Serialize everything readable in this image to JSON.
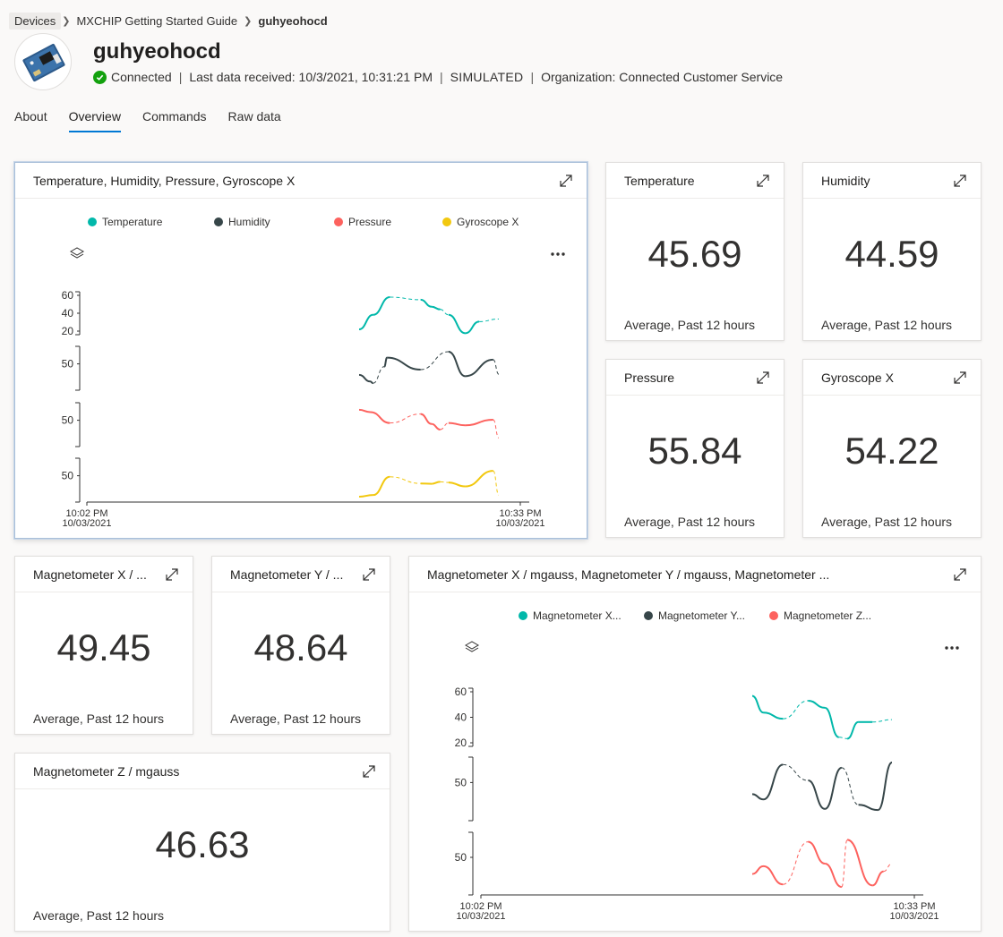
{
  "breadcrumb": [
    "Devices",
    "MXCHIP Getting Started Guide",
    "guhyeohocd"
  ],
  "device": {
    "name": "guhyeohocd",
    "status": "Connected",
    "last_data": "Last data received: 10/3/2021, 10:31:21 PM",
    "simulated": "SIMULATED",
    "organization": "Organization: Connected Customer Service"
  },
  "tabs": [
    "About",
    "Overview",
    "Commands",
    "Raw data"
  ],
  "active_tab": "Overview",
  "colors": {
    "teal": "#01b8aa",
    "dark": "#374649",
    "red": "#fd625e",
    "yellow": "#f2c80f",
    "accent": "#0078d4",
    "connected": "#13a10e"
  },
  "kpis": {
    "temperature": {
      "title": "Temperature",
      "value": "45.69",
      "sub": "Average, Past 12 hours"
    },
    "humidity": {
      "title": "Humidity",
      "value": "44.59",
      "sub": "Average, Past 12 hours"
    },
    "pressure": {
      "title": "Pressure",
      "value": "55.84",
      "sub": "Average, Past 12 hours"
    },
    "gyro": {
      "title": "Gyroscope X",
      "value": "54.22",
      "sub": "Average, Past 12 hours"
    },
    "magx": {
      "title": "Magnetometer X / ...",
      "value": "49.45",
      "sub": "Average, Past 12 hours"
    },
    "magy": {
      "title": "Magnetometer Y / ...",
      "value": "48.64",
      "sub": "Average, Past 12 hours"
    },
    "magz": {
      "title": "Magnetometer Z / mgauss",
      "value": "46.63",
      "sub": "Average, Past 12 hours"
    }
  },
  "chart_data": [
    {
      "type": "line",
      "title": "Temperature, Humidity, Pressure, Gyroscope X",
      "x_start": [
        "10:02 PM",
        "10/03/2021"
      ],
      "x_end": [
        "10:33 PM",
        "10/03/2021"
      ],
      "legend_position": "top",
      "grid": false,
      "series": [
        {
          "name": "Temperature",
          "color": "#01b8aa",
          "y_ticks": [
            "60",
            "40",
            "20"
          ],
          "points": [
            [
              0.0,
              0.0
            ],
            [
              0.1,
              0.45
            ],
            [
              0.22,
              1.0
            ],
            [
              0.44,
              0.92
            ],
            [
              0.52,
              0.7
            ],
            [
              0.58,
              0.62
            ],
            [
              0.64,
              0.45
            ],
            [
              0.76,
              -0.12
            ],
            [
              0.86,
              0.24
            ],
            [
              1.0,
              0.32
            ]
          ]
        },
        {
          "name": "Humidity",
          "color": "#374649",
          "y_ticks": [
            "50"
          ],
          "points": [
            [
              0.0,
              0.3
            ],
            [
              0.08,
              0.1
            ],
            [
              0.1,
              0.05
            ],
            [
              0.18,
              0.55
            ],
            [
              0.2,
              0.82
            ],
            [
              0.44,
              0.46
            ],
            [
              0.64,
              1.0
            ],
            [
              0.76,
              0.26
            ],
            [
              0.96,
              0.76
            ],
            [
              1.0,
              0.32
            ]
          ]
        },
        {
          "name": "Pressure",
          "color": "#fd625e",
          "y_ticks": [
            "50"
          ],
          "points": [
            [
              0.0,
              0.95
            ],
            [
              0.08,
              0.88
            ],
            [
              0.22,
              0.55
            ],
            [
              0.44,
              0.82
            ],
            [
              0.52,
              0.52
            ],
            [
              0.58,
              0.35
            ],
            [
              0.64,
              0.55
            ],
            [
              0.76,
              0.48
            ],
            [
              0.96,
              0.65
            ],
            [
              1.0,
              0.1
            ]
          ]
        },
        {
          "name": "Gyroscope X",
          "color": "#f2c80f",
          "y_ticks": [
            "50"
          ],
          "points": [
            [
              0.0,
              0.0
            ],
            [
              0.1,
              0.05
            ],
            [
              0.22,
              0.6
            ],
            [
              0.44,
              0.4
            ],
            [
              0.52,
              0.39
            ],
            [
              0.58,
              0.45
            ],
            [
              0.64,
              0.43
            ],
            [
              0.76,
              0.31
            ],
            [
              0.96,
              0.78
            ],
            [
              1.0,
              0.05
            ]
          ]
        }
      ]
    },
    {
      "type": "line",
      "title": "Magnetometer X / mgauss, Magnetometer Y / mgauss, Magnetometer ...",
      "x_start": [
        "10:02 PM",
        "10/03/2021"
      ],
      "x_end": [
        "10:33 PM",
        "10/03/2021"
      ],
      "legend_position": "top",
      "grid": false,
      "series": [
        {
          "name": "Magnetometer X...",
          "color": "#01b8aa",
          "y_ticks": [
            "60",
            "40",
            "20"
          ],
          "points": [
            [
              0.0,
              0.95
            ],
            [
              0.08,
              0.6
            ],
            [
              0.22,
              0.47
            ],
            [
              0.4,
              0.85
            ],
            [
              0.52,
              0.7
            ],
            [
              0.62,
              0.08
            ],
            [
              0.68,
              0.05
            ],
            [
              0.76,
              0.4
            ],
            [
              0.86,
              0.4
            ],
            [
              1.0,
              0.45
            ]
          ]
        },
        {
          "name": "Magnetometer Y...",
          "color": "#374649",
          "y_ticks": [
            "50"
          ],
          "points": [
            [
              0.0,
              0.4
            ],
            [
              0.08,
              0.3
            ],
            [
              0.22,
              0.96
            ],
            [
              0.4,
              0.66
            ],
            [
              0.52,
              0.12
            ],
            [
              0.64,
              0.9
            ],
            [
              0.76,
              0.2
            ],
            [
              0.9,
              0.1
            ],
            [
              1.0,
              1.0
            ]
          ]
        },
        {
          "name": "Magnetometer Z...",
          "color": "#fd625e",
          "y_ticks": [
            "50"
          ],
          "points": [
            [
              0.0,
              0.3
            ],
            [
              0.08,
              0.45
            ],
            [
              0.22,
              0.1
            ],
            [
              0.4,
              0.92
            ],
            [
              0.52,
              0.5
            ],
            [
              0.64,
              0.05
            ],
            [
              0.68,
              0.96
            ],
            [
              0.86,
              0.08
            ],
            [
              0.94,
              0.35
            ],
            [
              1.0,
              0.5
            ]
          ]
        }
      ]
    }
  ]
}
